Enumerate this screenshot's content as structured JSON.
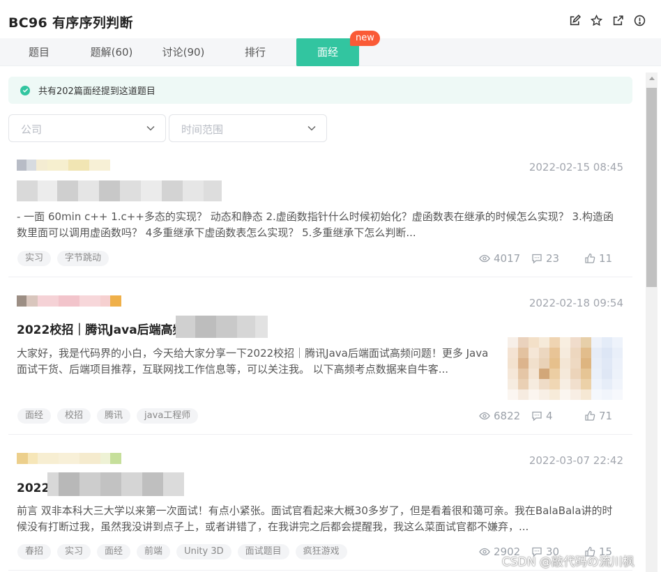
{
  "page": {
    "title": "BC96  有序序列判断",
    "icons": [
      "edit-icon",
      "star-icon",
      "external-link-icon",
      "info-icon"
    ]
  },
  "tabs": [
    {
      "label": "题目",
      "active": false
    },
    {
      "label": "题解(60)",
      "active": false
    },
    {
      "label": "讨论(90)",
      "active": false
    },
    {
      "label": "排行",
      "active": false
    },
    {
      "label": "面经",
      "active": true
    }
  ],
  "new_badge": "new",
  "notice": {
    "text": "共有202篇面经提到这道题目"
  },
  "filters": {
    "company_placeholder": "公司",
    "time_placeholder": "时间范围"
  },
  "posts": [
    {
      "date": "2022-02-15 08:45",
      "title": "",
      "excerpt": "- 一面 60min c++ 1.c++多态的实现？ 动态和静态 2.虚函数指针什么时候初始化？虚函数表在继承的时候怎么实现？ 3.构造函数里面可以调用虚函数吗？ 4多重继承下虚函数表怎么实现？ 5.多重继承下怎么判断...",
      "tags": [
        "实习",
        "字节跳动"
      ],
      "views": "4017",
      "comments": "23",
      "likes": "11"
    },
    {
      "date": "2022-02-18 09:54",
      "title": "2022校招｜腾讯Java后端高频",
      "excerpt": "大家好，我是代码界的小白，今天给大家分享一下2022校招｜腾讯Java后端面试高频问题！更多 Java面试干货、后端项目推荐，互联网找工作信息等，可以关注我。 以下高频考点数据来自牛客...",
      "tags": [
        "面经",
        "校招",
        "腾讯",
        "java工程师"
      ],
      "views": "6822",
      "comments": "4",
      "likes": "71"
    },
    {
      "date": "2022-03-07 22:42",
      "title": "2022                    端实习一面",
      "excerpt": "前言 双非本科大三大学以来第一次面试！有点小紧张。面试官看起来大概30多岁了，但是看着很和蔼可亲。我在BalaBala讲的时候没有打断过我，虽然我没讲到点子上，或者讲错了，在我讲完之后都会提醒我，我这么菜面试官都不嫌弃，...",
      "tags": [
        "春招",
        "实习",
        "面经",
        "前端",
        "Unity 3D",
        "面试题目",
        "疯狂游戏"
      ],
      "views": "2902",
      "comments": "30",
      "likes": "15"
    }
  ],
  "watermark": "CSDN @敲代码の流川枫",
  "colors": {
    "accent": "#32c5a0",
    "badge": "#fa5a36"
  }
}
